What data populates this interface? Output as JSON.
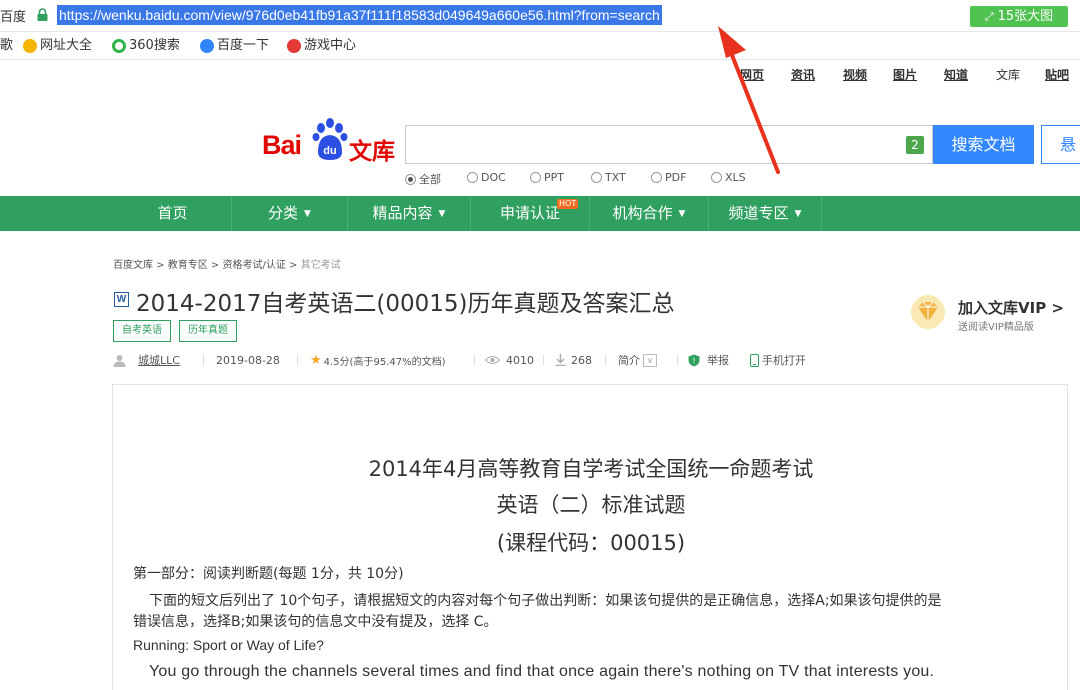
{
  "browser": {
    "addr_label": "百度",
    "url": "https://wenku.baidu.com/view/976d0eb41fb91a37f111f18583d049649a660e56.html?from=search",
    "image_button": "15张大图"
  },
  "bookmarks": [
    {
      "label": "歌",
      "color": ""
    },
    {
      "label": "网址大全",
      "color": "#f5b400"
    },
    {
      "label": "360搜索",
      "color": "#2fb34a"
    },
    {
      "label": "百度一下",
      "color": "#3385ff"
    },
    {
      "label": "游戏中心",
      "color": "#e53935"
    }
  ],
  "top_links": [
    "网页",
    "资讯",
    "视频",
    "图片",
    "知道",
    "文库",
    "贴吧"
  ],
  "logo": {
    "bai": "Bai",
    "du": "du",
    "wenku": "文库"
  },
  "search": {
    "badge": "2",
    "button": "搜索文档",
    "button2": "悬",
    "filters": [
      "全部",
      "DOC",
      "PPT",
      "TXT",
      "PDF",
      "XLS"
    ]
  },
  "nav": {
    "items": [
      "首页",
      "分类",
      "精品内容",
      "申请认证",
      "机构合作",
      "频道专区"
    ],
    "caret": "▼",
    "hot": "HOT"
  },
  "breadcrumb": [
    "百度文库",
    "教育专区",
    "资格考试/认证",
    "其它考试"
  ],
  "doc": {
    "icon": "W",
    "title": "2014-2017自考英语二(00015)历年真题及答案汇总",
    "tags": [
      "自考英语",
      "历年真题"
    ],
    "author": "城城LLC",
    "date": "2019-08-28",
    "rating": "4.5分(高于95.47%的文档)",
    "views": "4010",
    "downloads": "268",
    "intro": "简介",
    "report": "举报",
    "mobile": "手机打开"
  },
  "vip": {
    "title": "加入文库VIP >",
    "subtitle": "送阅读VIP精品版"
  },
  "page": {
    "h1": "2014年4月高等教育自学考试全国统一命题考试",
    "h2": "英语（二）标准试题",
    "h3": "(课程代码：00015)",
    "p1": "第一部分：阅读判断题(每题 1分，共 10分)",
    "p2": "下面的短文后列出了 10个句子，请根据短文的内容对每个句子做出判断：如果该句提供的是正确信息，选择A;如果该句提供的是",
    "p3": "错误信息，选择B;如果该句的信息文中没有提及，选择 C。",
    "p4": "Running: Sport or Way of Life?",
    "p5": "You go through the channels several times and find that once again there's nothing on TV that interests you."
  },
  "colors": {
    "nav_green": "#2fa05f",
    "search_blue": "#3388ff",
    "logo_red": "#e10602",
    "annotation_red": "#e8321e"
  }
}
